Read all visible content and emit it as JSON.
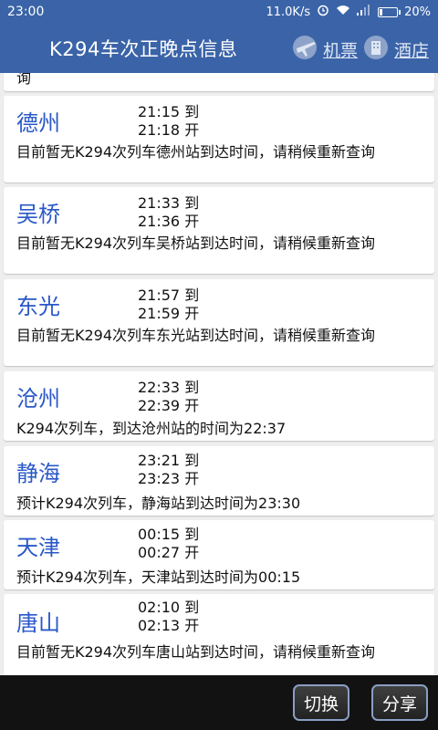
{
  "status_bar": {
    "time": "23:00",
    "speed": "11.0K/s",
    "battery": "20%",
    "battery_level": 0.2
  },
  "header": {
    "title": "K294车次正晚点信息",
    "flights_label": "机票",
    "hotel_label": "酒店"
  },
  "top_fragment": "询",
  "stations": [
    {
      "name": "德州",
      "arrive": "21:15 到",
      "depart": "21:18 开",
      "message": "目前暂无K294次列车德州站到达时间，请稍候重新查询"
    },
    {
      "name": "吴桥",
      "arrive": "21:33 到",
      "depart": "21:36 开",
      "message": "目前暂无K294次列车吴桥站到达时间，请稍候重新查询"
    },
    {
      "name": "东光",
      "arrive": "21:57 到",
      "depart": "21:59 开",
      "message": "目前暂无K294次列车东光站到达时间，请稍候重新查询"
    },
    {
      "name": "沧州",
      "arrive": "22:33 到",
      "depart": "22:39 开",
      "message": "K294次列车，到达沧州站的时间为22:37"
    },
    {
      "name": "静海",
      "arrive": "23:21 到",
      "depart": "23:23 开",
      "message": "预计K294次列车，静海站到达时间为23:30"
    },
    {
      "name": "天津",
      "arrive": "00:15 到",
      "depart": "00:27 开",
      "message": "预计K294次列车，天津站到达时间为00:15"
    },
    {
      "name": "唐山",
      "arrive": "02:10 到",
      "depart": "02:13 开",
      "message": "目前暂无K294次列车唐山站到达时间，请稍候重新查询"
    }
  ],
  "bottom_bar": {
    "switch_label": "切换",
    "share_label": "分享"
  },
  "colors": {
    "header_bg": "#3b64a8",
    "station_text": "#2a58c9",
    "bottom_bg": "#121212"
  }
}
